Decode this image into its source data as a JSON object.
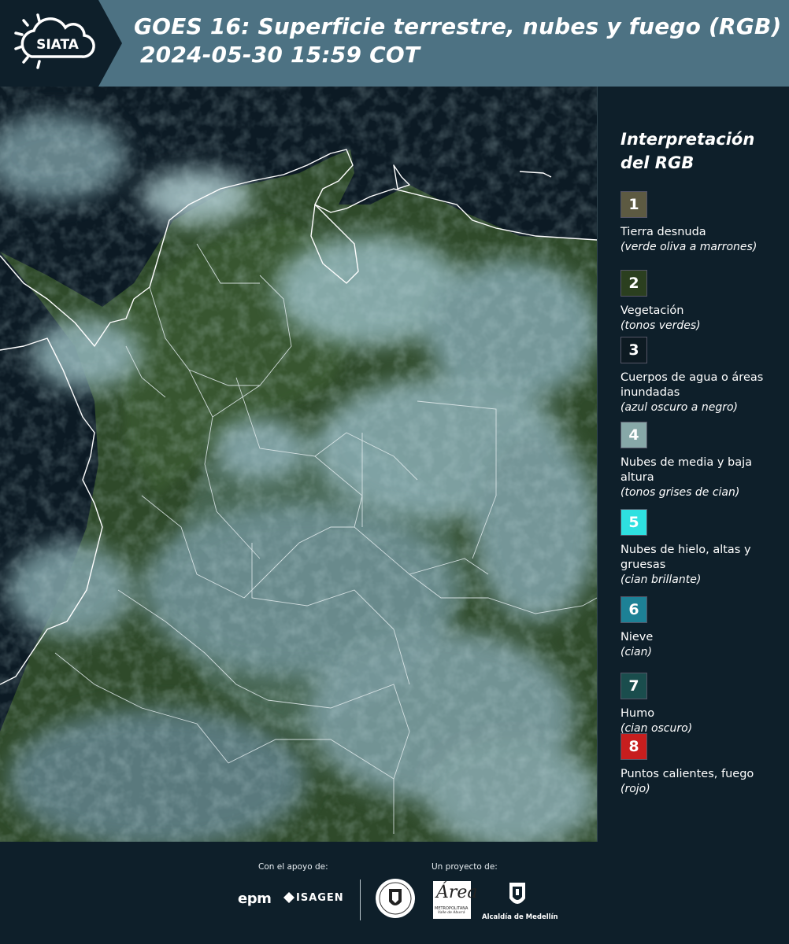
{
  "header": {
    "logo_text": "SIATA",
    "title_line1": "GOES 16: Superficie terrestre, nubes y fuego (RGB)",
    "title_line2": "2024-05-30 15:59 COT"
  },
  "legend": {
    "title": "Interpretación del RGB",
    "items": [
      {
        "num": "1",
        "color": "#5d5a42",
        "label": "Tierra desnuda",
        "note": "(verde oliva a marrones)"
      },
      {
        "num": "2",
        "color": "#2b3f1f",
        "label": "Vegetación",
        "note": "(tonos verdes)"
      },
      {
        "num": "3",
        "color": "#0d1a22",
        "label": "Cuerpos de agua o áreas inundadas",
        "note": "(azul oscuro a negro)"
      },
      {
        "num": "4",
        "color": "#87a8a8",
        "label": "Nubes de media y baja altura",
        "note": "(tonos grises de cian)"
      },
      {
        "num": "5",
        "color": "#2ee0e0",
        "label": "Nubes de hielo, altas y gruesas",
        "note": "(cian brillante)"
      },
      {
        "num": "6",
        "color": "#1d8196",
        "label": "Nieve",
        "note": "(cian)"
      },
      {
        "num": "7",
        "color": "#1a4d4d",
        "label": "Humo",
        "note": "(cian oscuro)"
      },
      {
        "num": "8",
        "color": "#c71e1e",
        "label": "Puntos calientes, fuego",
        "note": "(rojo)"
      }
    ]
  },
  "footer": {
    "support_label": "Con el apoyo de:",
    "project_label": "Un proyecto de:",
    "epm": "epm",
    "isagen": "ISAGEN",
    "area_a": "Área",
    "area_t1": "METROPOLITANA",
    "area_t2": "Valle de Aburrá",
    "medellin": "Alcaldía de Medellín"
  },
  "colors": {
    "header_bg": "#4d7283",
    "panel_bg": "#0e1f2a",
    "ocean": "#0c1a24",
    "vegetation": "#2f4a2a",
    "cloud": "#8fb3b6"
  }
}
